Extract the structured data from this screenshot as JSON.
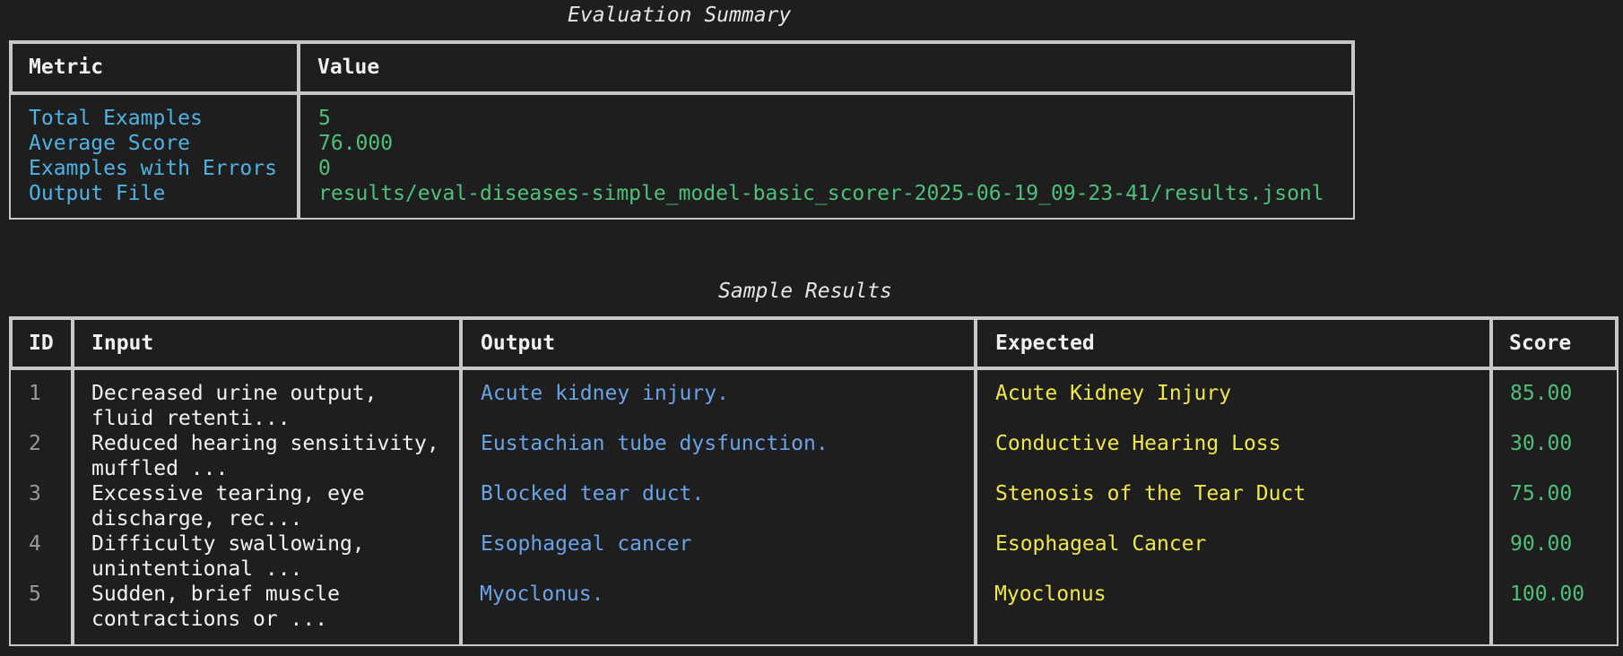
{
  "summary": {
    "title": "Evaluation Summary",
    "headers": [
      "Metric",
      "Value"
    ],
    "rows": [
      {
        "metric": "Total Examples",
        "value": "5"
      },
      {
        "metric": "Average Score",
        "value": "76.000"
      },
      {
        "metric": "Examples with Errors",
        "value": "0"
      },
      {
        "metric": "Output File",
        "value": "results/eval-diseases-simple_model-basic_scorer-2025-06-19_09-23-41/results.jsonl"
      }
    ]
  },
  "results": {
    "title": "Sample Results",
    "headers": [
      "ID",
      "Input",
      "Output",
      "Expected",
      "Score"
    ],
    "rows": [
      {
        "id": "1",
        "input_line1": "Decreased urine output,",
        "input_line2": "fluid retenti...",
        "output": "Acute kidney injury.",
        "expected": "Acute Kidney Injury",
        "score": "85.00"
      },
      {
        "id": "2",
        "input_line1": "Reduced hearing sensitivity,",
        "input_line2": "muffled ...",
        "output": "Eustachian tube dysfunction.",
        "expected": "Conductive Hearing Loss",
        "score": "30.00"
      },
      {
        "id": "3",
        "input_line1": "Excessive tearing, eye",
        "input_line2": "discharge, rec...",
        "output": "Blocked tear duct.",
        "expected": "Stenosis of the Tear Duct",
        "score": "75.00"
      },
      {
        "id": "4",
        "input_line1": "Difficulty swallowing,",
        "input_line2": "unintentional ...",
        "output": "Esophageal cancer",
        "expected": "Esophageal Cancer",
        "score": "90.00"
      },
      {
        "id": "5",
        "input_line1": "Sudden, brief muscle",
        "input_line2": "contractions or ...",
        "output": "Myoclonus.",
        "expected": "Myoclonus",
        "score": "100.00"
      }
    ]
  },
  "colors": {
    "background": "#1e1e1e",
    "border": "#c8c8c8",
    "metric_text": "#4fb3e6",
    "value_text": "#4ec07a",
    "output_text": "#6aa3e6",
    "expected_text": "#f0e84a"
  }
}
